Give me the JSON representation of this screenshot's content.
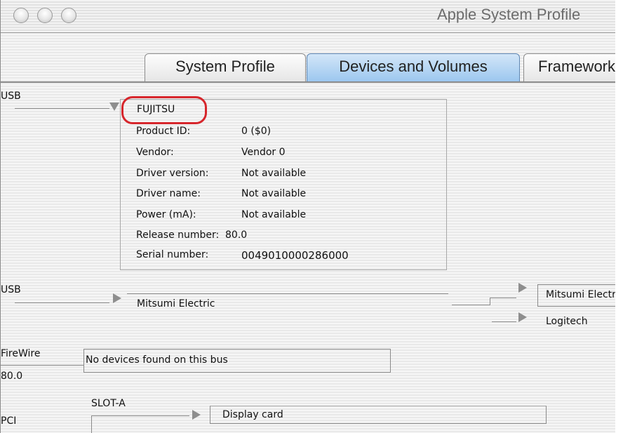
{
  "window": {
    "title": "Apple System Profile"
  },
  "tabs": [
    {
      "label": "System Profile",
      "active": false
    },
    {
      "label": "Devices and Volumes",
      "active": true
    },
    {
      "label": "Frameworks",
      "active": false
    }
  ],
  "usb1": {
    "bus_label": "USB",
    "device": {
      "name": "FUJITSU",
      "properties": [
        {
          "key": "Product ID:",
          "value": "0 ($0)"
        },
        {
          "key": "Vendor:",
          "value": "Vendor 0"
        },
        {
          "key": "Driver version:",
          "value": "Not available"
        },
        {
          "key": "Driver name:",
          "value": "Not available"
        },
        {
          "key": "Power (mA):",
          "value": "Not available"
        },
        {
          "key": "Release number:",
          "value": "80.0"
        },
        {
          "key": "Serial number:",
          "value": "0049010000286000"
        }
      ]
    }
  },
  "usb2": {
    "bus_label": "USB",
    "device": "Mitsumi Electric",
    "children": [
      "Mitsumi Electric",
      "Logitech"
    ]
  },
  "firewire": {
    "bus_label": "FireWire",
    "version": "80.0",
    "message": "No devices found on this bus"
  },
  "pci": {
    "bus_label": "PCI",
    "slot": "SLOT-A",
    "device": "Display card"
  },
  "colors": {
    "active_tab": "#9cc7ef",
    "highlight": "#d6262c"
  }
}
